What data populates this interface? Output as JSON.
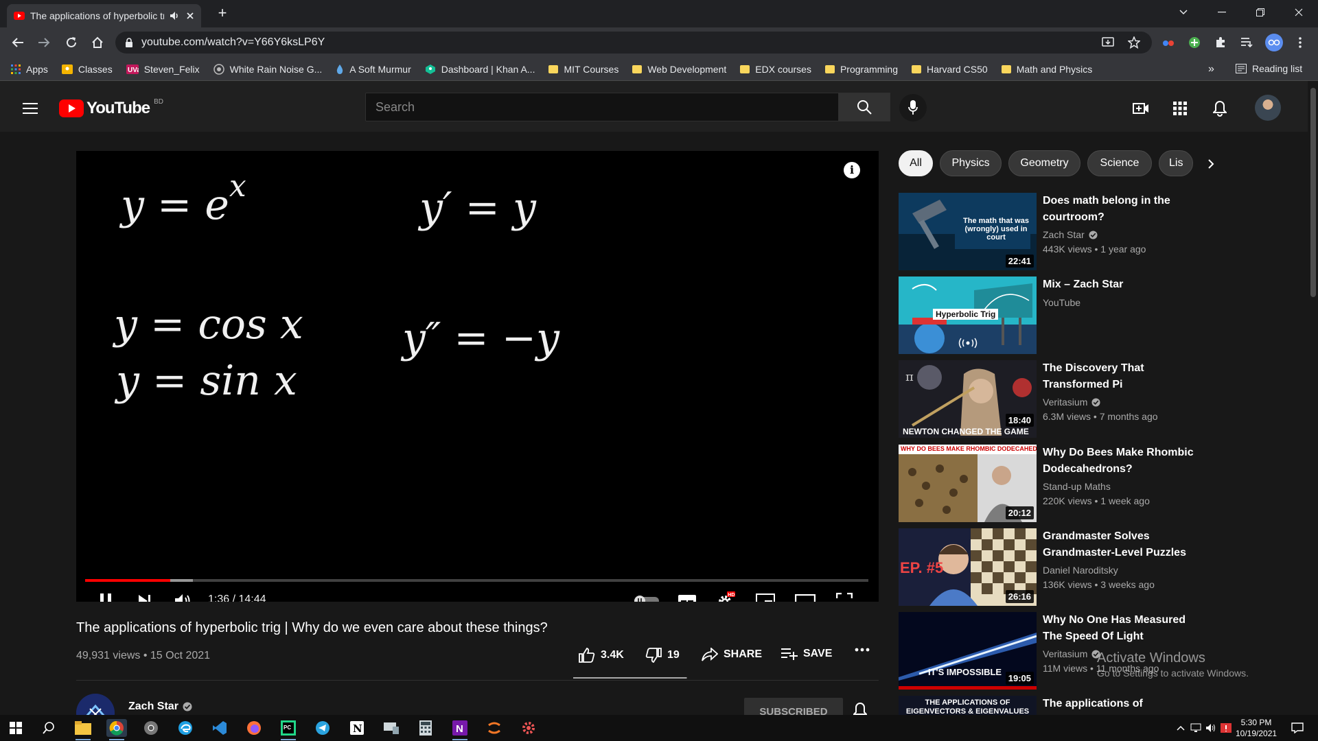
{
  "browser": {
    "tab_title": "The applications of hyperbolic trig",
    "url": "youtube.com/watch?v=Y66Y6ksLP6Y",
    "bookmarks": [
      "Apps",
      "Classes",
      "Steven_Felix",
      "White Rain Noise G...",
      "A Soft Murmur",
      "Dashboard | Khan A...",
      "MIT Courses",
      "Web Development",
      "EDX courses",
      "Programming",
      "Harvard CS50",
      "Math and Physics"
    ],
    "bookmarks_more": "»",
    "reading_list": "Reading list"
  },
  "masthead": {
    "logo_text": "YouTube",
    "country": "BD",
    "search_placeholder": "Search"
  },
  "player": {
    "equations": {
      "e1": "y = e",
      "e1_exp": "x",
      "e2": "y′ = y",
      "e3": "y = cos x",
      "e4": "y = sin x",
      "e5": "y″ = −y"
    },
    "time_display": "1:36 / 14:44",
    "played_fraction": 0.1085,
    "buffered_fraction": 0.1375,
    "hd_badge": "HD"
  },
  "video": {
    "title": "The applications of hyperbolic trig | Why do we even care about these things?",
    "views_date": "49,931 views • 15 Oct 2021",
    "likes": "3.4K",
    "dislikes": "19",
    "share_label": "SHARE",
    "save_label": "SAVE",
    "like_ratio": 0.9945,
    "channel": "Zach Star",
    "subscribe_label": "SUBSCRIBED"
  },
  "chips": [
    "All",
    "Physics",
    "Geometry",
    "Science",
    "Lis"
  ],
  "related": [
    {
      "title": "Does math belong in the courtroom?",
      "channel": "Zach Star",
      "verified": true,
      "meta": "443K views • 1 year ago",
      "duration": "22:41",
      "thumb_text": "The math that was (wrongly) used in court"
    },
    {
      "title": "Mix – Zach Star",
      "channel": "YouTube",
      "verified": false,
      "meta": "",
      "duration": "",
      "thumb_text": "Hyperbolic Trig"
    },
    {
      "title": "The Discovery That Transformed Pi",
      "channel": "Veritasium",
      "verified": true,
      "meta": "6.3M views • 7 months ago",
      "duration": "18:40",
      "thumb_text": "NEWTON CHANGED THE GAME"
    },
    {
      "title": "Why Do Bees Make Rhombic Dodecahedrons?",
      "channel": "Stand-up Maths",
      "verified": false,
      "meta": "220K views • 1 week ago",
      "duration": "20:12",
      "thumb_text": "WHY DO BEES MAKE RHOMBIC DODECAHEDRONS?"
    },
    {
      "title": "Grandmaster Solves Grandmaster-Level Puzzles",
      "channel": "Daniel Naroditsky",
      "verified": false,
      "meta": "136K views • 3 weeks ago",
      "duration": "26:16",
      "thumb_text": "EP. #5"
    },
    {
      "title": "Why No One Has Measured The Speed Of Light",
      "channel": "Veritasium",
      "verified": true,
      "meta": "11M views • 11 months ago",
      "duration": "19:05",
      "thumb_text": "IT'S IMPOSSIBLE"
    },
    {
      "title": "The applications of",
      "channel": "",
      "verified": false,
      "meta": "",
      "duration": "",
      "thumb_text": "THE APPLICATIONS OF EIGENVECTORS & EIGENVALUES"
    }
  ],
  "watermark": {
    "line1": "Activate Windows",
    "line2": "Go to Settings to activate Windows."
  },
  "taskbar": {
    "time": "5:30 PM",
    "date": "10/19/2021"
  },
  "colors": {
    "youtube_red": "#ff0000",
    "background": "#181818",
    "masthead": "#202020"
  }
}
